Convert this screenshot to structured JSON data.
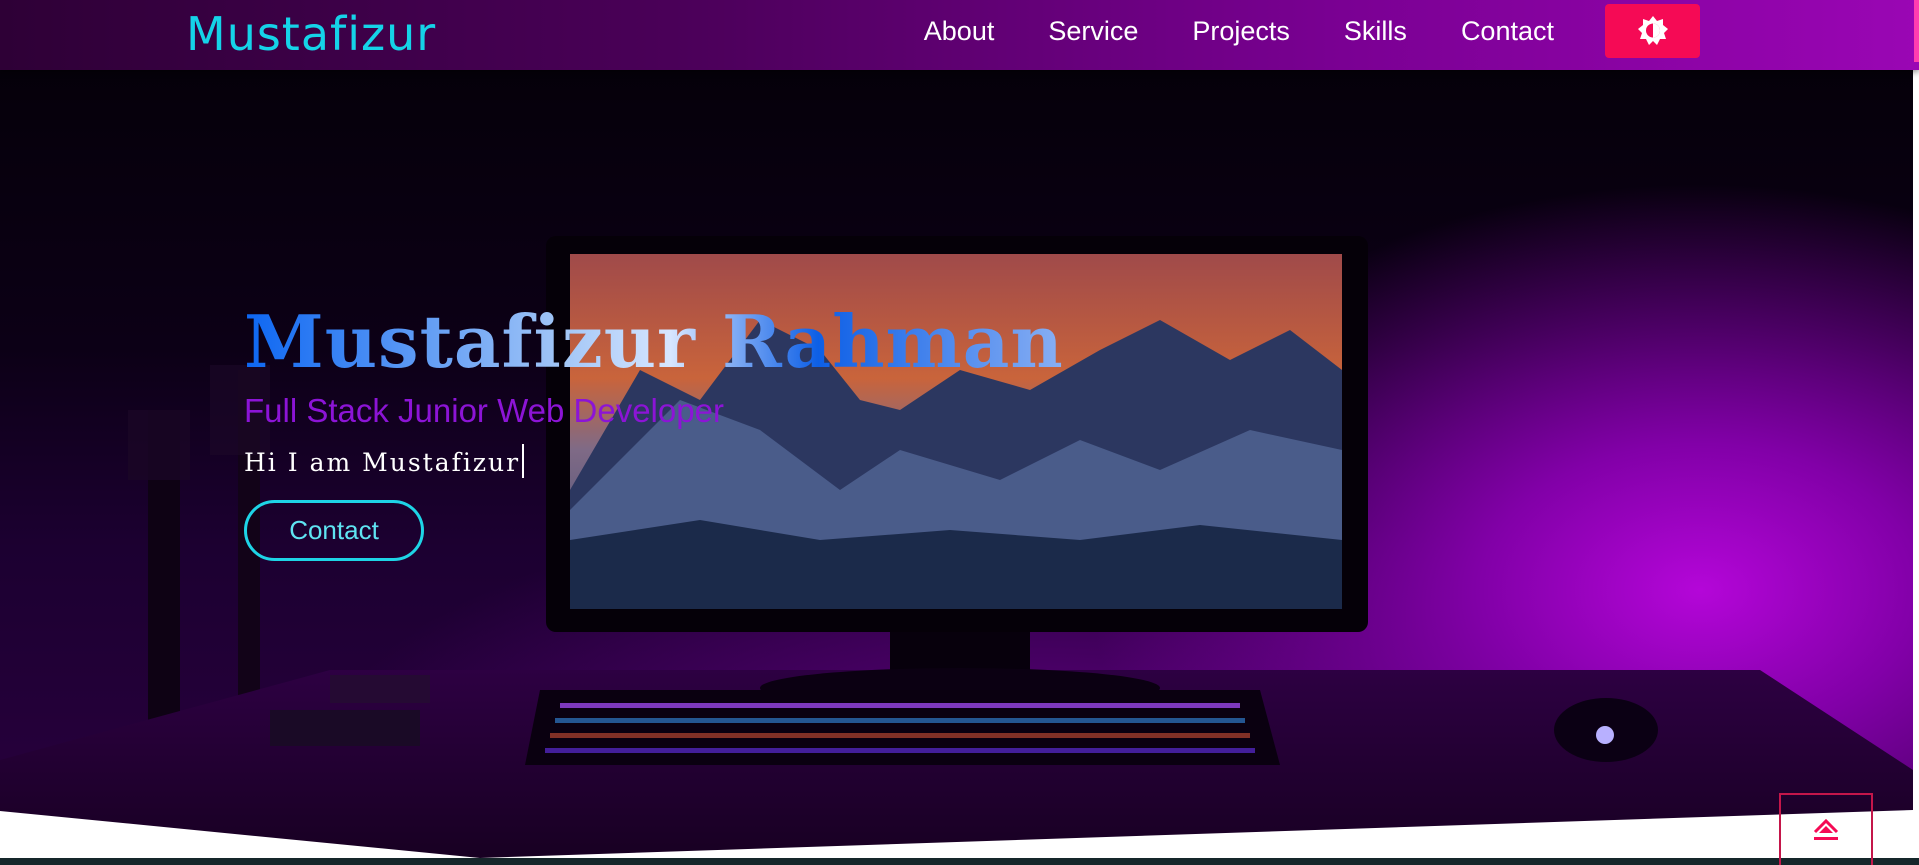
{
  "header": {
    "logo": "Mustafizur",
    "nav": [
      "About",
      "Service",
      "Projects",
      "Skills",
      "Contact"
    ]
  },
  "hero": {
    "name": "Mustafizur Rahman",
    "subtitle": "Full Stack Junior Web Developer",
    "typed_text": "Hi I am Mustafizur",
    "contact_label": "Contact"
  },
  "colors": {
    "nav_gradient": [
      "#2e0036",
      "#9a06b4"
    ],
    "accent_pink": "#f50a55",
    "accent_cyan": "#15d3e8",
    "subtitle_purple": "#8c14d6"
  },
  "icons": {
    "theme_toggle": "brightness-icon",
    "back_to_top": "eject-arrow-icon"
  }
}
